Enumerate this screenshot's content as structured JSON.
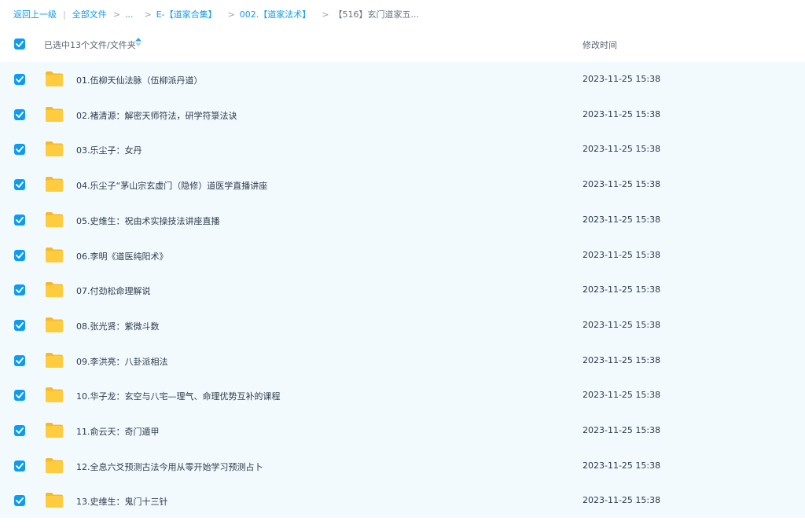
{
  "breadcrumb": {
    "back": "返回上一级",
    "separator": "|",
    "all_files": "全部文件",
    "arrow": ">",
    "ellipsis": "...",
    "level1": "E-【道家合集】",
    "level2": "002.【道家法术】",
    "current": "【516】玄门道家五..."
  },
  "header": {
    "selected": "已选中13个文件/文件夹",
    "sort_icon": "sort-arrows-icon",
    "modified": "修改时间"
  },
  "colors": {
    "accent": "#0f9cf0",
    "row_selected_bg": "#f3fafe",
    "folder": "#ffc83d"
  },
  "files": [
    {
      "name": "01.伍柳天仙法脉（伍柳派丹道）",
      "time": "2023-11-25 15:38",
      "checked": true
    },
    {
      "name": "02.褚清源：解密天师符法，研学符箓法诀",
      "time": "2023-11-25 15:38",
      "checked": true
    },
    {
      "name": "03.乐尘子：女丹",
      "time": "2023-11-25 15:38",
      "checked": true
    },
    {
      "name": "04.乐尘子“茅山宗玄虚门（隐修）道医学直播讲座",
      "time": "2023-11-25 15:38",
      "checked": true
    },
    {
      "name": "05.史维生：祝由术实操技法讲座直播",
      "time": "2023-11-25 15:38",
      "checked": true
    },
    {
      "name": "06.李明《道医纯阳术》",
      "time": "2023-11-25 15:38",
      "checked": true
    },
    {
      "name": "07.付劲松命理解说",
      "time": "2023-11-25 15:38",
      "checked": true
    },
    {
      "name": "08.张光贤：紫微斗数",
      "time": "2023-11-25 15:38",
      "checked": true
    },
    {
      "name": "09.李洪亮：八卦派相法",
      "time": "2023-11-25 15:38",
      "checked": true
    },
    {
      "name": "10.华子龙：玄空与八宅—理气、命理优势互补的课程",
      "time": "2023-11-25 15:38",
      "checked": true
    },
    {
      "name": "11.俞云天：奇门遁甲",
      "time": "2023-11-25 15:38",
      "checked": true
    },
    {
      "name": "12.全息六爻预测古法今用从零开始学习预测占卜",
      "time": "2023-11-25 15:38",
      "checked": true
    },
    {
      "name": "13.史维生：鬼门十三针",
      "time": "2023-11-25 15:38",
      "checked": true
    }
  ]
}
